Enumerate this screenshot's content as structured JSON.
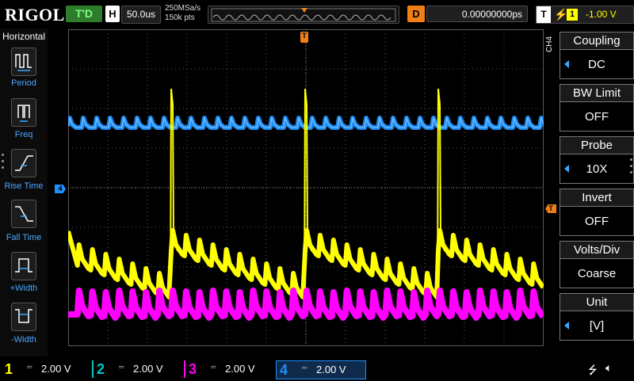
{
  "header": {
    "logo": "RIGOL",
    "run_status": "T'D",
    "timebase_label": "H",
    "timebase_value": "50.0us",
    "sample_rate": "250MSa/s",
    "memory_depth": "150k pts",
    "delay_label": "D",
    "delay_value": "0.00000000ps",
    "trigger_label": "T",
    "trigger_source": "1",
    "trigger_level": "-1.00 V"
  },
  "left_menu": {
    "title": "Horizontal",
    "items": [
      {
        "label": "Period",
        "icon": "period-icon"
      },
      {
        "label": "Freq",
        "icon": "frequency-icon"
      },
      {
        "label": "Rise Time",
        "icon": "rise-time-icon"
      },
      {
        "label": "Fall Time",
        "icon": "fall-time-icon"
      },
      {
        "label": "+Width",
        "icon": "positive-width-icon"
      },
      {
        "label": "-Width",
        "icon": "negative-width-icon"
      }
    ]
  },
  "right_menu": {
    "channel": "CH4",
    "items": [
      {
        "title": "Coupling",
        "value": "DC",
        "has_arrow": true
      },
      {
        "title": "BW Limit",
        "value": "OFF",
        "has_arrow": false
      },
      {
        "title": "Probe",
        "value": "10X",
        "has_arrow": true
      },
      {
        "title": "Invert",
        "value": "OFF",
        "has_arrow": false
      },
      {
        "title": "Volts/Div",
        "value": "Coarse",
        "has_arrow": false
      },
      {
        "title": "Unit",
        "value": "[V]",
        "has_arrow": true
      }
    ]
  },
  "channels": [
    {
      "num": "1",
      "scale": "2.00 V",
      "color": "#ffff00"
    },
    {
      "num": "2",
      "scale": "2.00 V",
      "color": "#00c8c8"
    },
    {
      "num": "3",
      "scale": "2.00 V",
      "color": "#ff00ff"
    },
    {
      "num": "4",
      "scale": "2.00 V",
      "color": "#1e90ff"
    }
  ],
  "markers": {
    "trigger_top": "T",
    "trigger_right": "T",
    "ch4_left": "4"
  },
  "colors": {
    "grid": "#5a5a5a",
    "ch1": "#ffff00",
    "ch3": "#ff00ff",
    "ch4": "#1e90ff",
    "trigger": "#f07f16",
    "accent": "#3aa7ff"
  }
}
